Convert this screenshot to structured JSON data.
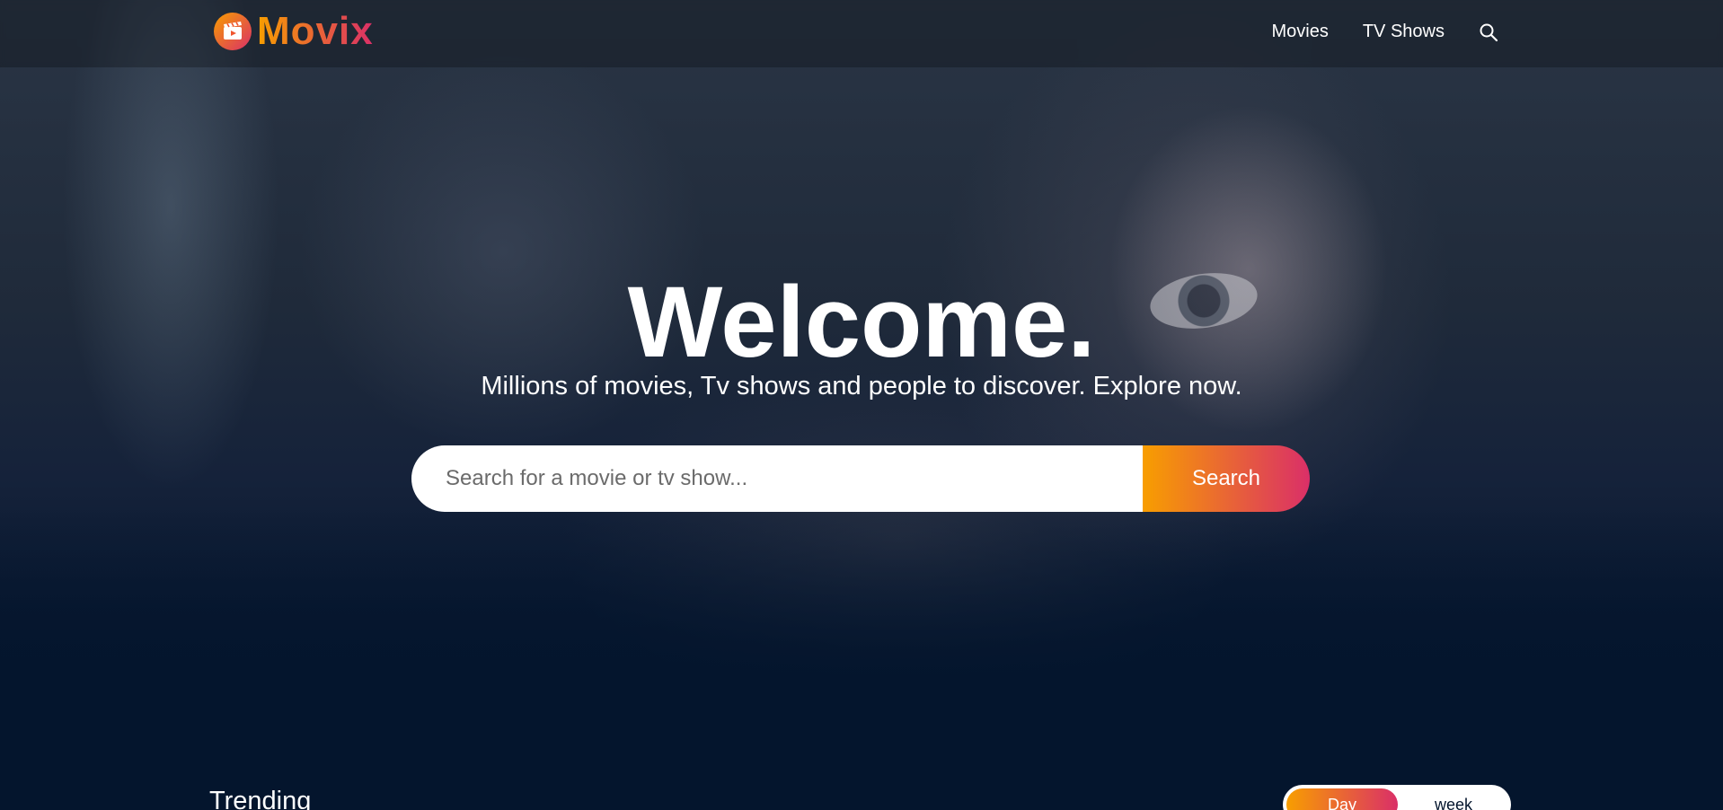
{
  "brand": {
    "name": "Movix",
    "colors": {
      "gradient_start": "#f89e00",
      "gradient_end": "#da2f68",
      "background": "#04152d"
    },
    "logo_icon": "movie-clapper-play-icon"
  },
  "nav": {
    "items": [
      {
        "label": "Movies"
      },
      {
        "label": "TV Shows"
      }
    ],
    "search_icon": "search-icon"
  },
  "hero": {
    "title": "Welcome.",
    "subtitle": "Millions of movies, Tv shows and people to discover. Explore now.",
    "search": {
      "placeholder": "Search for a movie or tv show...",
      "value": "",
      "button_label": "Search"
    }
  },
  "trending": {
    "title": "Trending",
    "tabs": [
      {
        "label": "Day",
        "active": true
      },
      {
        "label": "week",
        "active": false
      }
    ]
  }
}
